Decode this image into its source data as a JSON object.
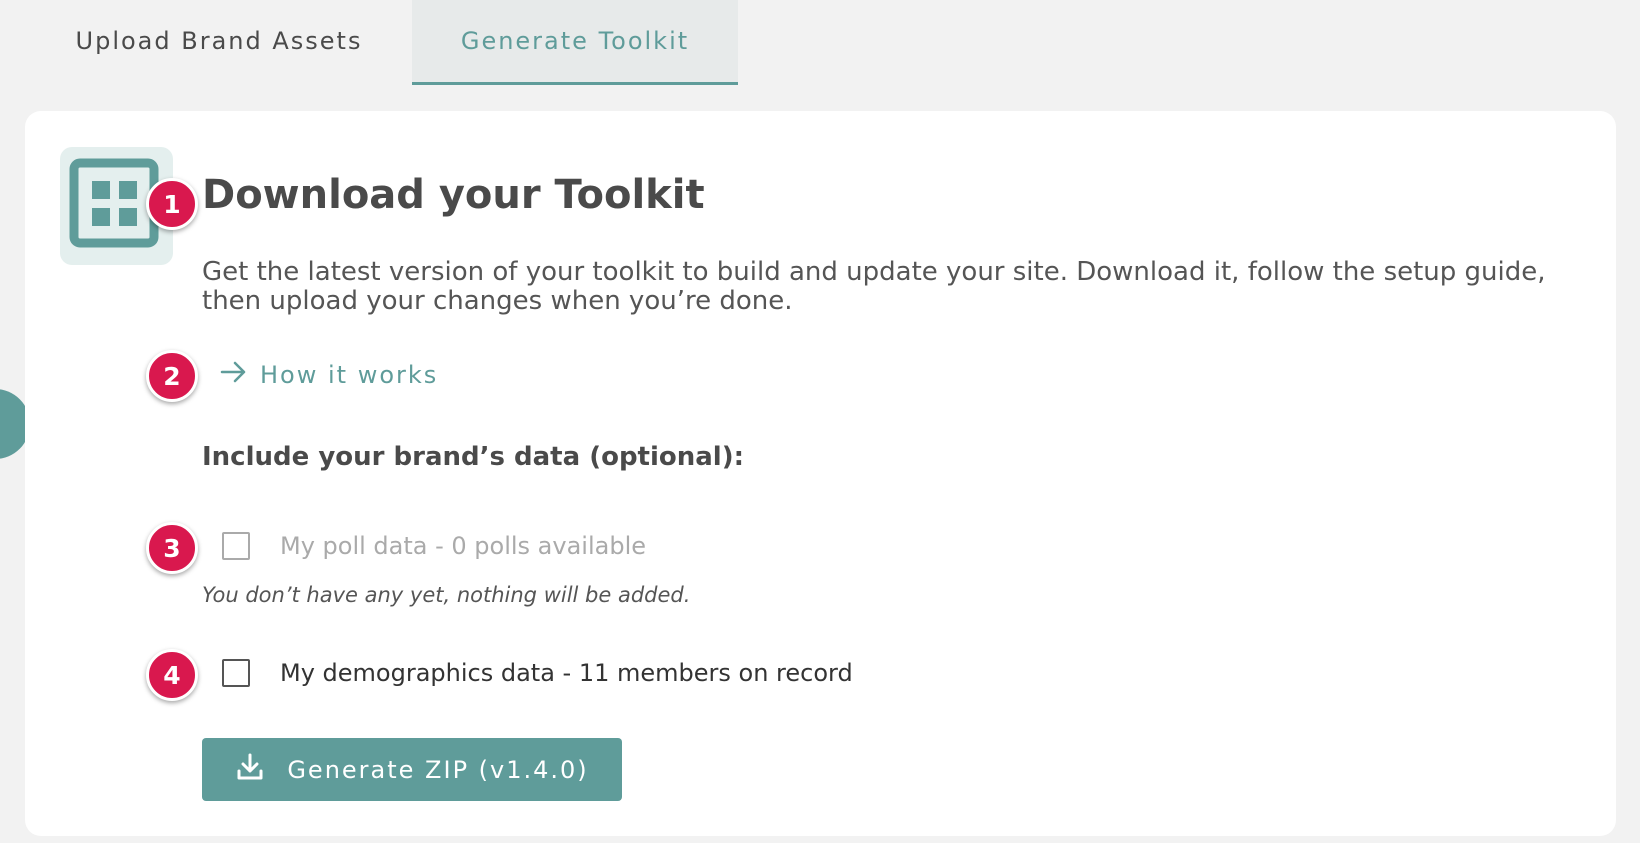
{
  "tabs": [
    {
      "label": "Upload Brand Assets",
      "active": false
    },
    {
      "label": "Generate Toolkit",
      "active": true
    }
  ],
  "main": {
    "icon": "grid-icon",
    "title": "Download your Toolkit",
    "description": "Get the latest version of your toolkit to build and update your site. Download it, follow the setup guide, then upload your changes when you’re done.",
    "how_it_works": {
      "label": "How it works",
      "icon": "arrow-right-icon"
    },
    "include_heading": "Include your brand’s data (optional):",
    "options": [
      {
        "label": "My poll data - 0 polls available",
        "checked": false,
        "disabled": true,
        "note": "You don’t have any yet, nothing will be added."
      },
      {
        "label": "My demographics data - 11 members on record",
        "checked": false,
        "disabled": false
      }
    ],
    "generate_button": {
      "label": "Generate ZIP (v1.4.0)",
      "icon": "download-icon"
    }
  },
  "markers": [
    "1",
    "2",
    "3",
    "4"
  ],
  "colors": {
    "accent": "#5f9c9a",
    "marker": "#d9184e",
    "background": "#f2f2f2",
    "card": "#ffffff"
  }
}
